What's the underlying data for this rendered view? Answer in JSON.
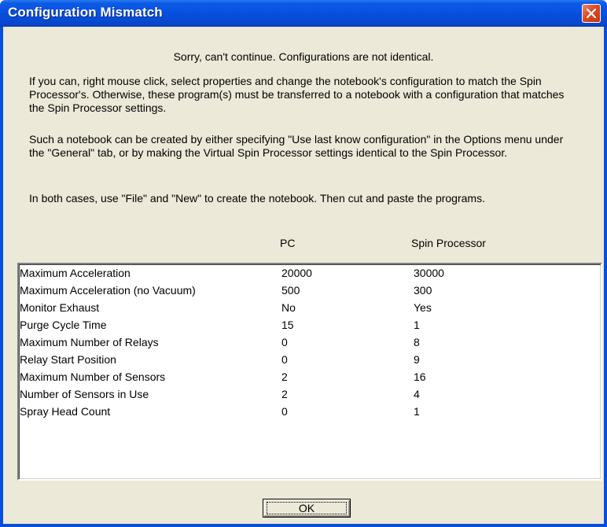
{
  "window": {
    "title": "Configuration Mismatch",
    "close_icon": "close-icon"
  },
  "message": {
    "headline": "Sorry, can't continue. Configurations are not identical.",
    "paragraph1": "If you can, right mouse click, select properties and change the notebook's configuration to match the Spin Processor's. Otherwise, these program(s) must be transferred to a notebook with a configuration that matches the Spin Processor settings.",
    "paragraph2": "Such a notebook can be created by either specifying \"Use last know configuration\" in the Options menu under the \"General\" tab, or by making the Virtual Spin Processor settings identical to the Spin Processor.",
    "paragraph3": "In both cases, use \"File\" and \"New\" to create the notebook. Then cut and paste the programs."
  },
  "table": {
    "headers": {
      "pc": "PC",
      "spin": "Spin Processor"
    },
    "rows": [
      {
        "name": "Maximum Acceleration",
        "pc": "20000",
        "spin": "30000"
      },
      {
        "name": "Maximum Acceleration (no Vacuum)",
        "pc": "500",
        "spin": "300"
      },
      {
        "name": "Monitor Exhaust",
        "pc": "No",
        "spin": "Yes"
      },
      {
        "name": "Purge Cycle Time",
        "pc": "15",
        "spin": "1"
      },
      {
        "name": "Maximum Number of Relays",
        "pc": "0",
        "spin": "8"
      },
      {
        "name": "Relay Start Position",
        "pc": "0",
        "spin": "9"
      },
      {
        "name": "Maximum Number of Sensors",
        "pc": "2",
        "spin": "16"
      },
      {
        "name": "Number of Sensors in Use",
        "pc": "2",
        "spin": "4"
      },
      {
        "name": "Spray Head Count",
        "pc": "0",
        "spin": "1"
      }
    ]
  },
  "buttons": {
    "ok": "OK"
  },
  "colors": {
    "titlebar": "#0a54e0",
    "client": "#ece9d8",
    "close": "#dc4a24"
  }
}
